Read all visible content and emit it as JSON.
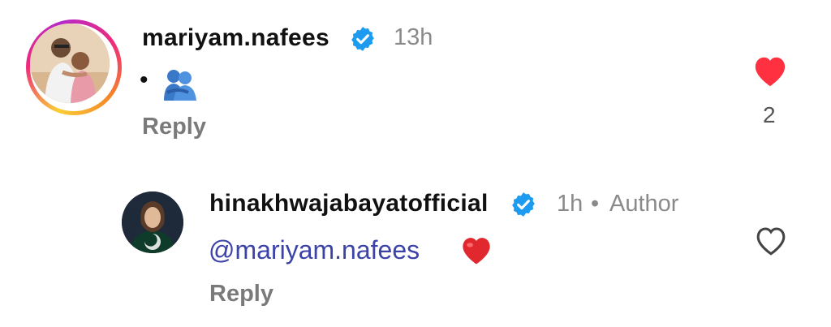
{
  "comments": [
    {
      "username": "mariyam.nafees",
      "time": "13h",
      "text_bullet": "•",
      "text_emoji": "🫂",
      "reply_label": "Reply",
      "like_count": "2",
      "liked": true
    },
    {
      "username": "hinakhwajabayatofficial",
      "time": "1h",
      "separator": "•",
      "author_label": "Author",
      "mention": "@mariyam.nafees",
      "emoji": "❤️",
      "reply_label": "Reply",
      "liked": false
    }
  ],
  "colors": {
    "verified_blue": "#1d9bf0",
    "like_red": "#ff3040",
    "mention_blue": "#3b42a8"
  },
  "icons": [
    "verified-badge-icon",
    "heart-filled-icon",
    "heart-outline-icon",
    "threads-at-icon",
    "hug-emoji-icon"
  ]
}
